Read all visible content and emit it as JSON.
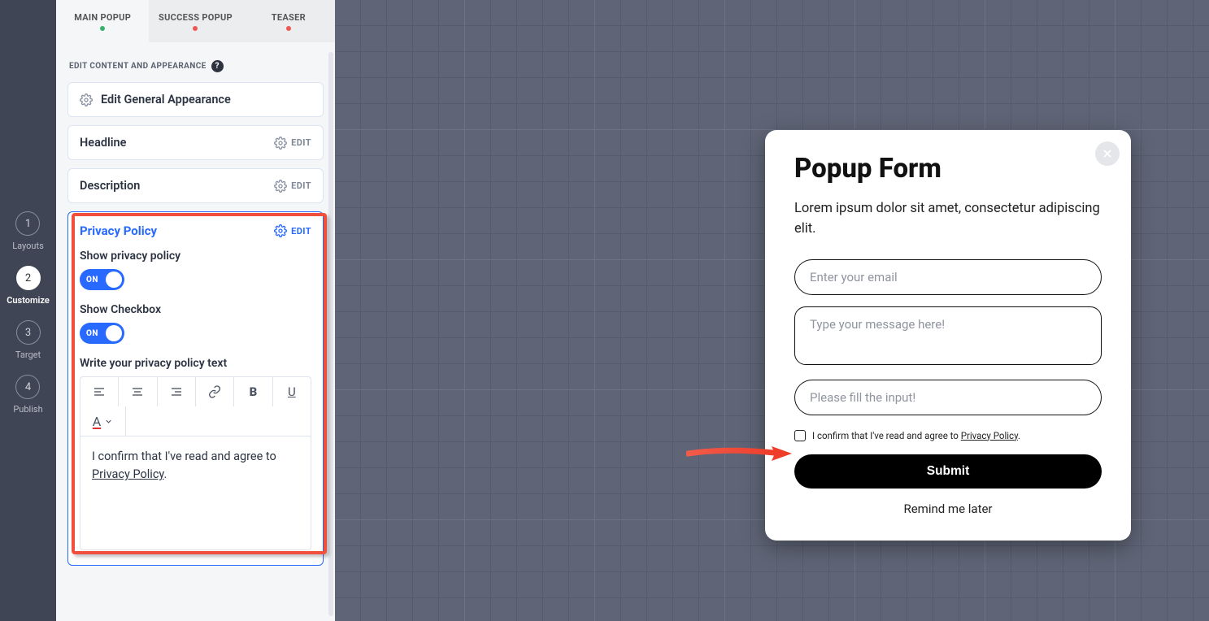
{
  "rail": {
    "steps": [
      {
        "num": "1",
        "label": "Layouts"
      },
      {
        "num": "2",
        "label": "Customize"
      },
      {
        "num": "3",
        "label": "Target"
      },
      {
        "num": "4",
        "label": "Publish"
      }
    ],
    "activeIndex": 1
  },
  "tabs": {
    "items": [
      {
        "label": "MAIN POPUP",
        "dot": "green"
      },
      {
        "label": "SUCCESS POPUP",
        "dot": "red"
      },
      {
        "label": "TEASER",
        "dot": "red"
      }
    ],
    "activeIndex": 0
  },
  "section_label": "EDIT CONTENT AND APPEARANCE",
  "cards": {
    "general": "Edit General Appearance",
    "headline": "Headline",
    "description": "Description",
    "edit": "EDIT"
  },
  "privacy": {
    "title": "Privacy Policy",
    "edit": "EDIT",
    "show_pp_label": "Show privacy policy",
    "show_cbx_label": "Show Checkbox",
    "toggle_on": "ON",
    "write_label": "Write your privacy policy text",
    "text_pre": "I confirm that I've read and agree to ",
    "text_link": "Privacy Policy",
    "text_post": "."
  },
  "popup": {
    "title": "Popup Form",
    "desc": "Lorem ipsum dolor sit amet, consectetur adipiscing elit.",
    "email_ph": "Enter your email",
    "msg_ph": "Type your message here!",
    "input3_ph": "Please fill the input!",
    "consent_pre": "I confirm that I've read and agree to ",
    "consent_link": "Privacy Policy",
    "consent_post": ".",
    "submit": "Submit",
    "remind": "Remind me later"
  }
}
